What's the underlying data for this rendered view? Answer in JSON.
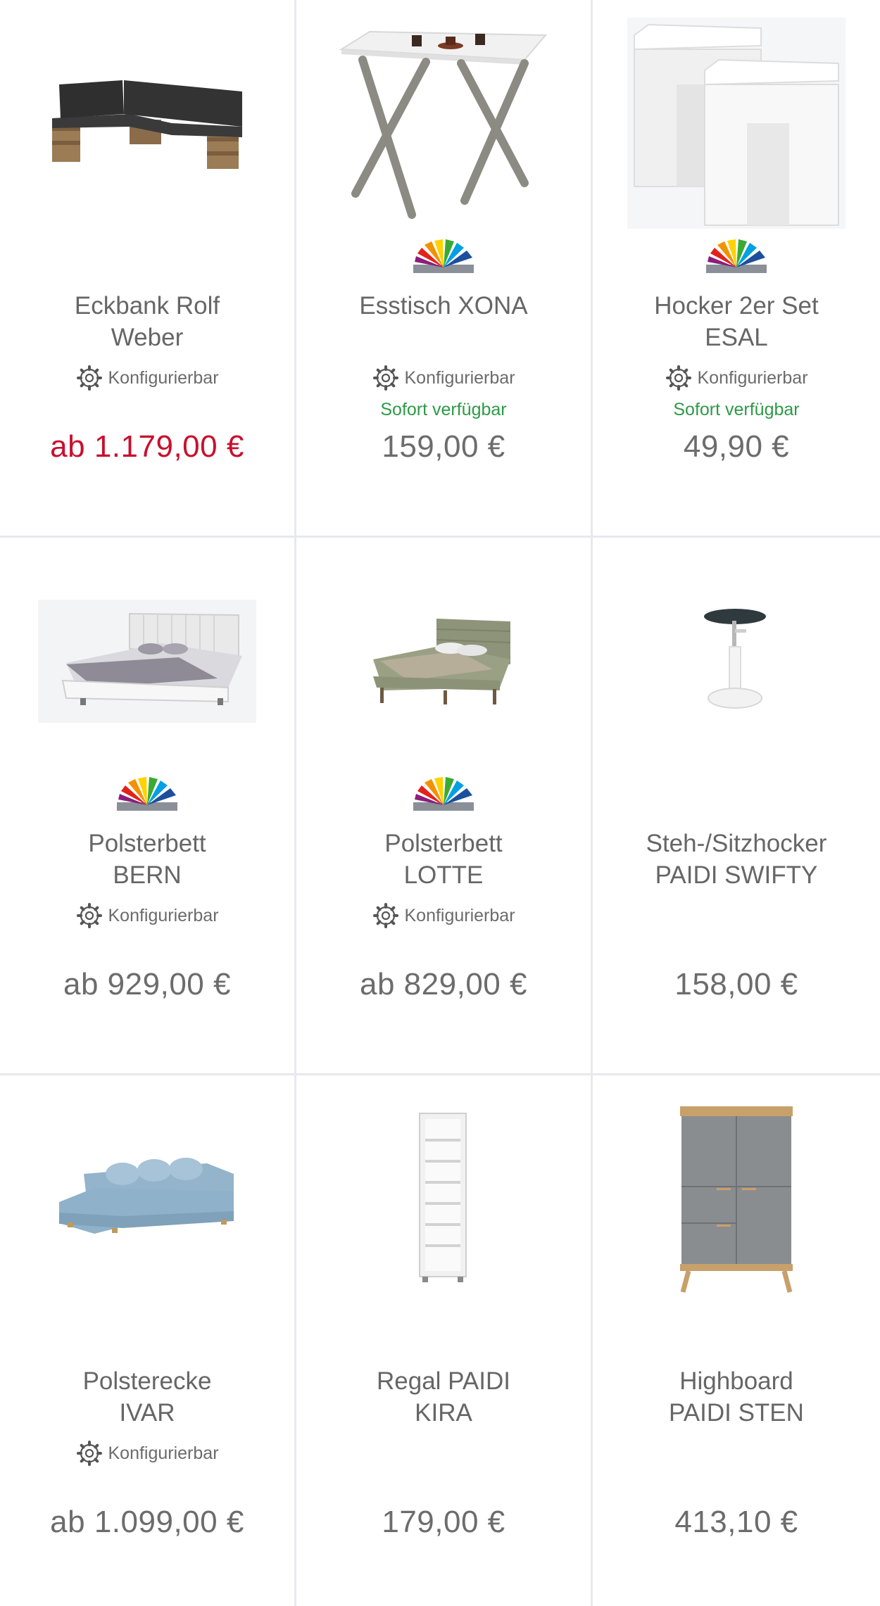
{
  "products": [
    {
      "name_line1": "Eckbank Rolf",
      "name_line2": "Weber",
      "config": "Konfigurierbar",
      "availability": "",
      "price": "ab 1.179,00 €",
      "price_red": true,
      "colors": false,
      "image": "corner-bench-image"
    },
    {
      "name_line1": "Esstisch XONA",
      "name_line2": "",
      "config": "Konfigurierbar",
      "availability": "Sofort verfügbar",
      "price": "159,00 €",
      "price_red": false,
      "colors": true,
      "image": "dining-table-image"
    },
    {
      "name_line1": "Hocker 2er Set",
      "name_line2": "ESAL",
      "config": "Konfigurierbar",
      "availability": "Sofort verfügbar",
      "price": "49,90 €",
      "price_red": false,
      "colors": true,
      "image": "stool-set-image"
    },
    {
      "name_line1": "Polsterbett",
      "name_line2": "BERN",
      "config": "Konfigurierbar",
      "availability": "",
      "price": "ab 929,00 €",
      "price_red": false,
      "colors": true,
      "image": "white-bed-image"
    },
    {
      "name_line1": "Polsterbett",
      "name_line2": "LOTTE",
      "config": "Konfigurierbar",
      "availability": "",
      "price": "ab 829,00 €",
      "price_red": false,
      "colors": true,
      "image": "green-bed-image"
    },
    {
      "name_line1": "Steh-/Sitzhocker",
      "name_line2": "PAIDI SWIFTY",
      "config": "",
      "availability": "",
      "price": "158,00 €",
      "price_red": false,
      "colors": false,
      "image": "standing-stool-image"
    },
    {
      "name_line1": "Polsterecke",
      "name_line2": "IVAR",
      "config": "Konfigurierbar",
      "availability": "",
      "price": "ab 1.099,00 €",
      "price_red": false,
      "colors": false,
      "image": "corner-sofa-image"
    },
    {
      "name_line1": "Regal PAIDI",
      "name_line2": "KIRA",
      "config": "",
      "availability": "",
      "price": "179,00 €",
      "price_red": false,
      "colors": false,
      "image": "shelf-image"
    },
    {
      "name_line1": "Highboard",
      "name_line2": "PAIDI STEN",
      "config": "",
      "availability": "",
      "price": "413,10 €",
      "price_red": false,
      "colors": false,
      "image": "highboard-image"
    }
  ],
  "colors": {
    "price_sale": "#c8102e",
    "availability": "#2d9a47",
    "divider": "#e6e9ed",
    "text": "#666666"
  }
}
